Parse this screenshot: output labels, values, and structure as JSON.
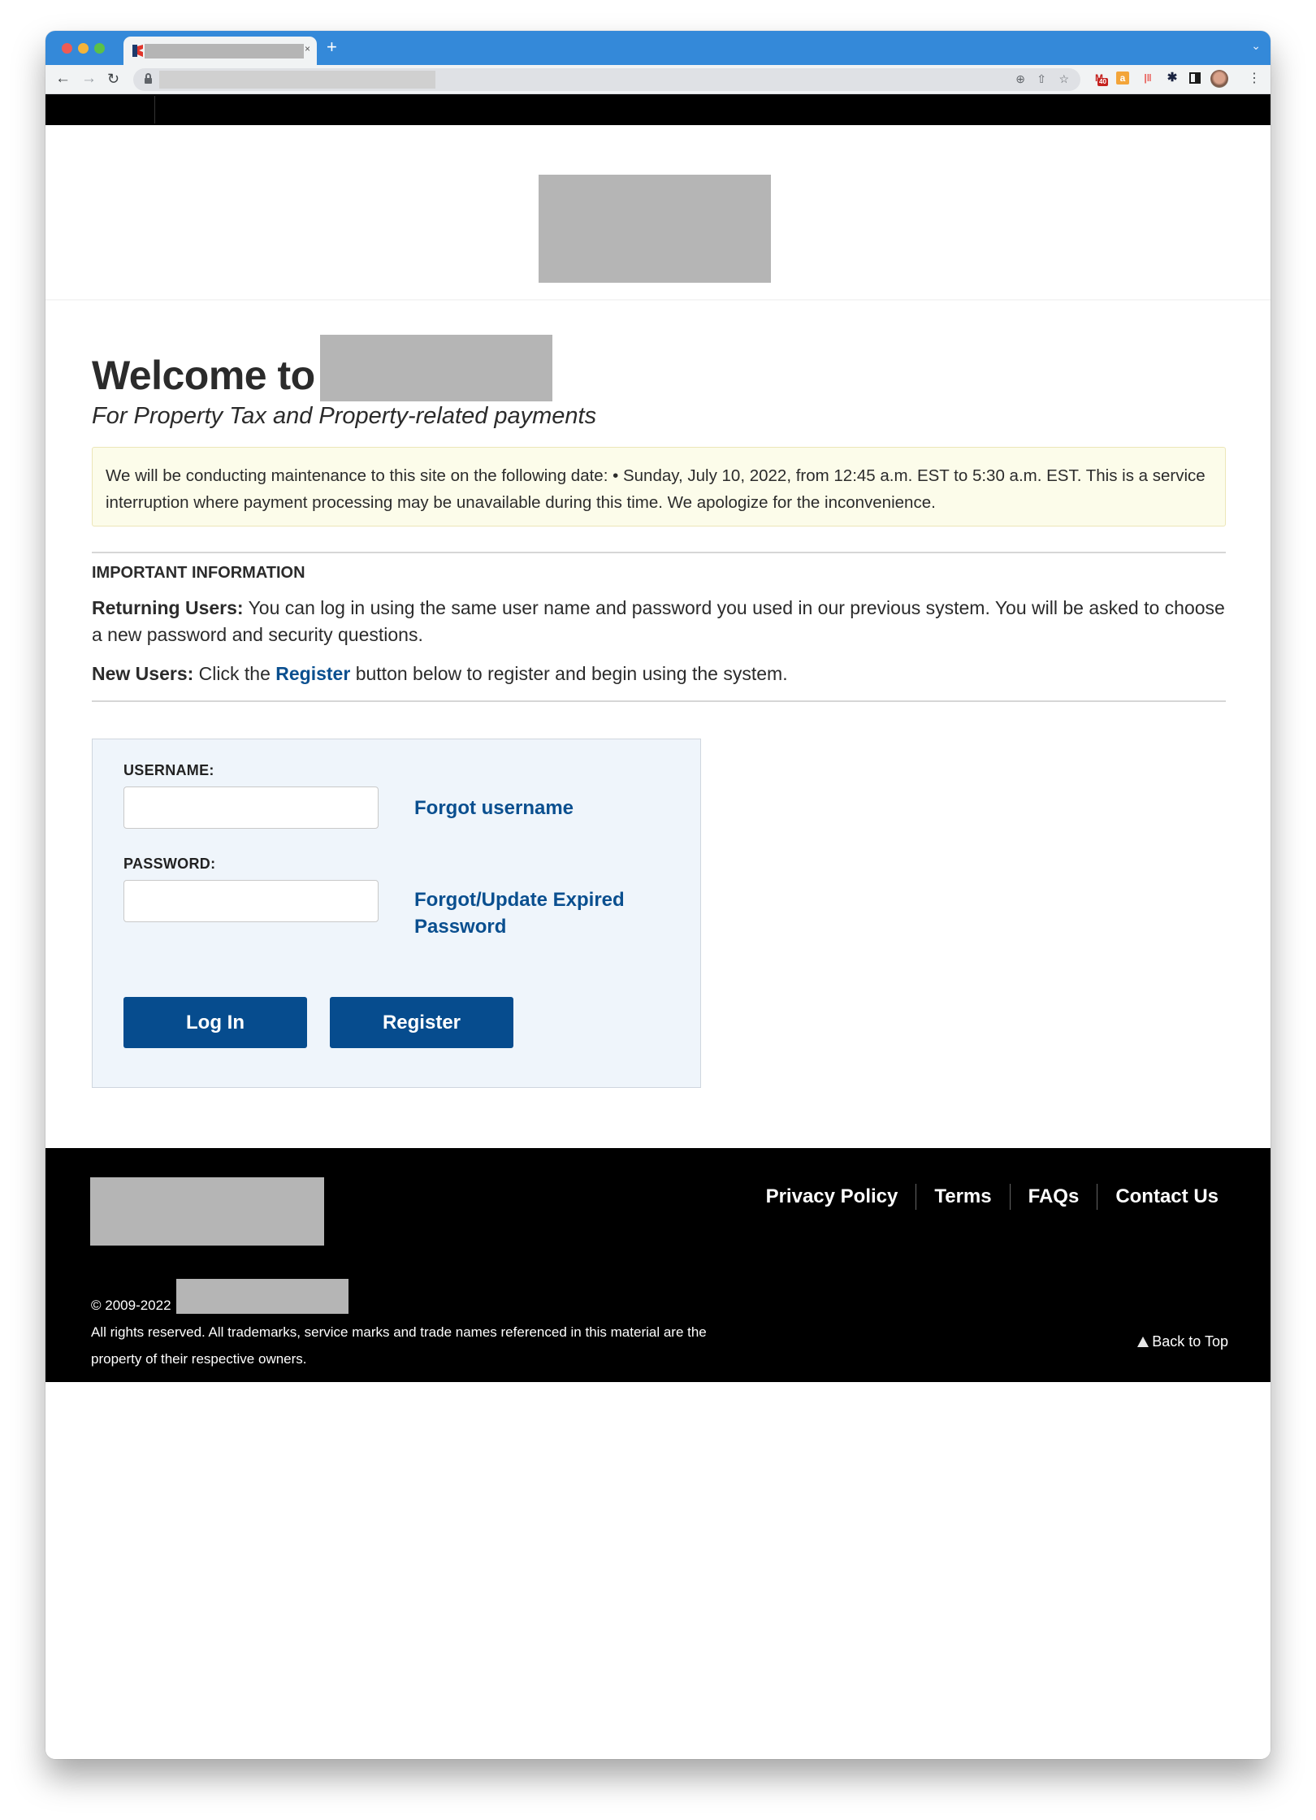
{
  "browser": {
    "tab": {
      "title_redacted": true,
      "close_glyph": "×"
    },
    "new_tab_glyph": "+",
    "tab_menu_glyph": "⌄",
    "nav": {
      "back_glyph": "←",
      "forward_glyph": "→",
      "reload_glyph": "↻"
    },
    "omnibox": {
      "url_redacted": true,
      "zoom_glyph": "⊕",
      "share_glyph": "⇧",
      "bookmark_glyph": "☆"
    },
    "extensions": {
      "gmail_glyph": "M",
      "gmail_badge": "40",
      "amazon_glyph": "a",
      "bars_glyph": "|‖",
      "puzzle_glyph": "✱"
    },
    "menu_glyph": "⋮"
  },
  "header": {
    "logo_redacted": true
  },
  "welcome": {
    "title": "Welcome to",
    "site_name_redacted": true,
    "subtitle": "For Property Tax and Property-related payments"
  },
  "notice": {
    "text": "We will be conducting maintenance to this site on the following date: • Sunday, July 10, 2022, from 12:45 a.m. EST to 5:30 a.m. EST. This is a service interruption where payment processing may be unavailable during this time. We apologize for the inconvenience."
  },
  "important": {
    "heading": "IMPORTANT INFORMATION",
    "returning_label": "Returning Users:",
    "returning_text": " You can log in using the same user name and password you used in our previous system. You will be asked to choose a new password and security questions.",
    "new_label": "New Users:",
    "new_text_before": " Click the ",
    "new_link": "Register",
    "new_text_after": " button below to register and begin using the system."
  },
  "login": {
    "username_label": "USERNAME:",
    "username_value": "",
    "password_label": "PASSWORD:",
    "password_value": "",
    "forgot_username": "Forgot username",
    "forgot_password": "Forgot/Update Expired Password",
    "login_button": "Log In",
    "register_button": "Register"
  },
  "footer": {
    "logo_redacted": true,
    "links": [
      "Privacy Policy",
      "Terms",
      "FAQs",
      "Contact Us"
    ],
    "copyright": "© 2009-2022",
    "owner_redacted": true,
    "rights": "All rights reserved. All trademarks, service marks and trade names referenced in this material are the property of their respective owners.",
    "back_to_top": "Back to Top"
  },
  "colors": {
    "browser_chrome": "#3489d9",
    "primary_button": "#064c8e",
    "link": "#0a4f8f",
    "notice_bg": "#fcfcea",
    "login_panel_bg": "#eff5fb",
    "footer_bg": "#000000",
    "redaction": "#b5b5b5"
  }
}
